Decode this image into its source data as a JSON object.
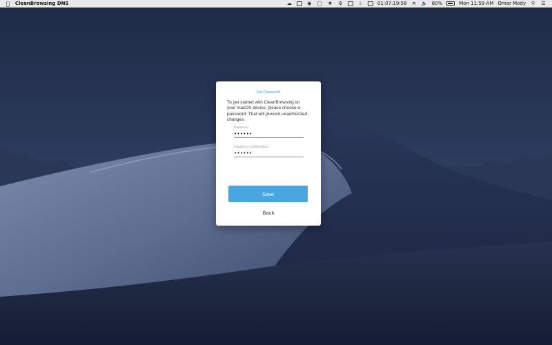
{
  "menubar": {
    "app_name": "CleanBrowsing DNS",
    "icons": [
      "apple-icon",
      "cloud-icon",
      "app-box-icon",
      "eye-icon",
      "shield-icon",
      "dropbox-icon",
      "gear-icon",
      "airplay-icon",
      "bluetooth-icon",
      "timer-icon",
      "wifi-icon",
      "volume-icon",
      "battery-icon",
      "search-icon",
      "list-icon"
    ],
    "timer": "01:07:19:58",
    "battery": "80%",
    "clock": "Mon 11:59 AM",
    "user": "Omar Mody"
  },
  "dialog": {
    "title": "Set Password",
    "description": "To get started with CleanBrowsing on your macOS device, please choose a password.  That will prevent unauthorized changes.",
    "password_label": "Password",
    "password_value": "••••••",
    "confirm_label": "Password Confirmation",
    "confirm_value": "••••••",
    "save_label": "Save",
    "back_label": "Back"
  },
  "colors": {
    "accent": "#49a6e0",
    "menubar_bg": "#e9e9ec",
    "sky_top": "#1f2b47",
    "sky_bottom": "#3c4e72"
  }
}
